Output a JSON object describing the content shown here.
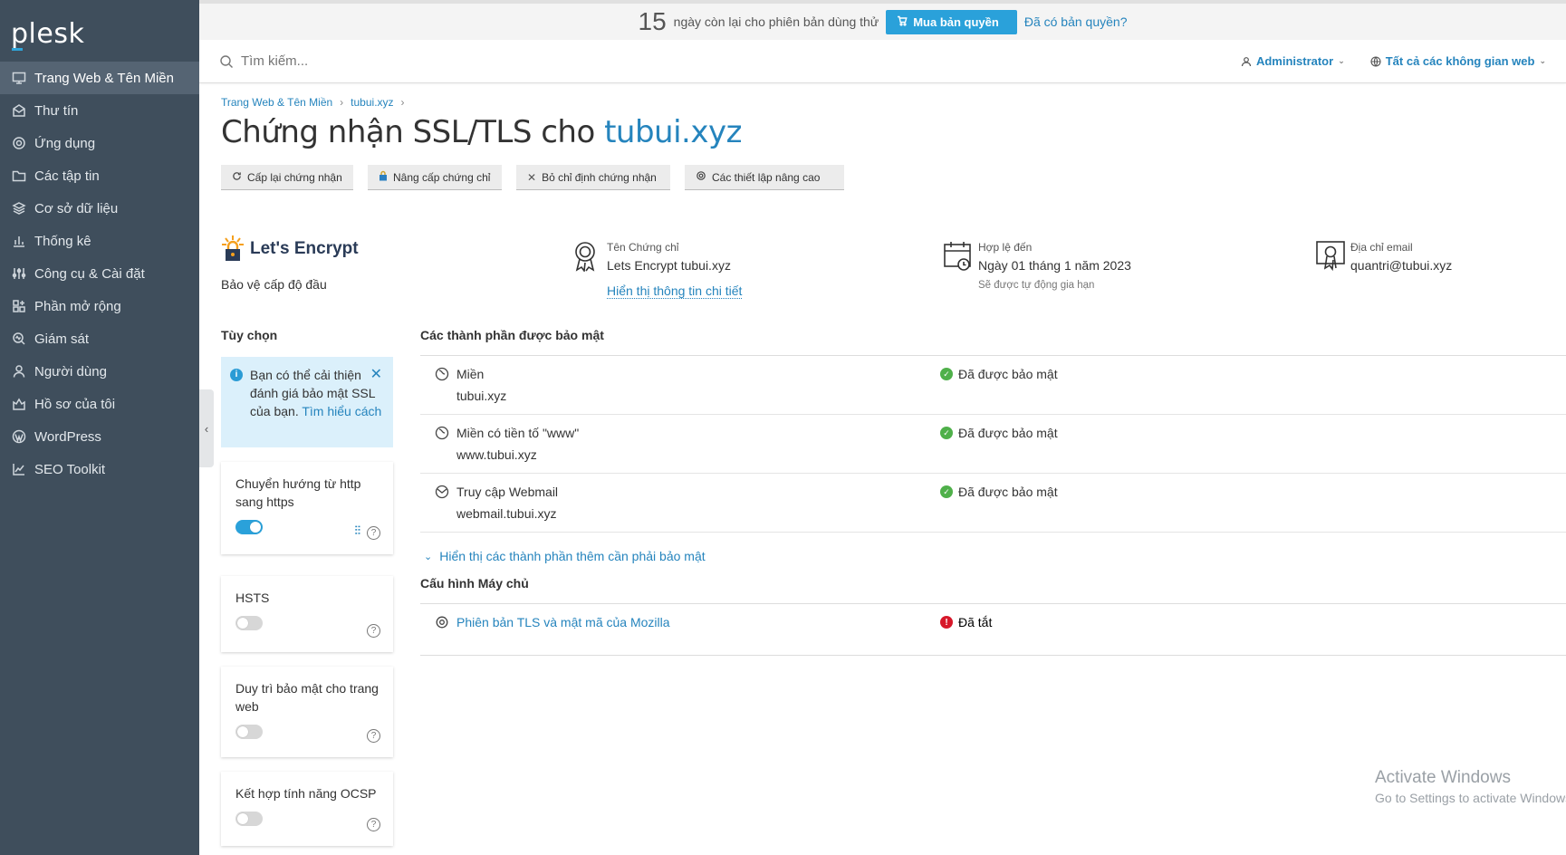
{
  "brand": "plesk",
  "sidebar": {
    "items": [
      {
        "label": "Trang Web & Tên Miền",
        "icon": "monitor-icon",
        "active": true
      },
      {
        "label": "Thư tín",
        "icon": "mail-icon"
      },
      {
        "label": "Ứng dụng",
        "icon": "gear-icon"
      },
      {
        "label": "Các tập tin",
        "icon": "folder-icon"
      },
      {
        "label": "Cơ sở dữ liệu",
        "icon": "layers-icon"
      },
      {
        "label": "Thống kê",
        "icon": "bar-chart-icon"
      },
      {
        "label": "Công cụ & Cài đặt",
        "icon": "sliders-icon"
      },
      {
        "label": "Phần mở rộng",
        "icon": "extensions-icon"
      },
      {
        "label": "Giám sát",
        "icon": "monitor-search-icon"
      },
      {
        "label": "Người dùng",
        "icon": "user-icon"
      },
      {
        "label": "Hồ sơ của tôi",
        "icon": "profile-icon"
      },
      {
        "label": "WordPress",
        "icon": "wordpress-icon"
      },
      {
        "label": "SEO Toolkit",
        "icon": "seo-chart-icon"
      }
    ]
  },
  "trial": {
    "days": "15",
    "text": "ngày còn lại cho phiên bản dùng thử",
    "buy_label": "Mua bản quyền",
    "have_license_label": "Đã có bản quyền?"
  },
  "search": {
    "placeholder": "Tìm kiếm..."
  },
  "topbar": {
    "user_label": "Administrator",
    "subscriptions_label": "Tất cả các không gian web"
  },
  "breadcrumb": {
    "item1": "Trang Web & Tên Miền",
    "item2": "tubui.xyz"
  },
  "page": {
    "title_prefix": "Chứng nhận SSL/TLS cho",
    "title_domain": "tubui.xyz"
  },
  "actions": {
    "reissue": "Cấp lại chứng nhận",
    "upgrade": "Nâng cấp chứng chỉ",
    "unassign": "Bỏ chỉ định chứng nhận",
    "advanced": "Các thiết lập nâng cao"
  },
  "overview": {
    "provider": "Let's Encrypt",
    "protection": "Bảo vệ cấp độ đầu",
    "cert_name_label": "Tên Chứng chỉ",
    "cert_name_value": "Lets Encrypt tubui.xyz",
    "cert_details_link": "Hiển thị thông tin chi tiết",
    "valid_label": "Hợp lệ đến",
    "valid_value": "Ngày 01 tháng 1 năm 2023",
    "valid_sub": "Sẽ được tự động gia hạn",
    "email_label": "Địa chỉ email",
    "email_value": "quantri@tubui.xyz"
  },
  "options": {
    "title": "Tùy chọn",
    "tip_text": "Bạn có thể cải thiện đánh giá bảo mật SSL của bạn.",
    "tip_link": "Tìm hiểu cách",
    "cards": [
      {
        "label": "Chuyển hướng từ http sang https",
        "on": true
      },
      {
        "label": "HSTS",
        "on": false
      },
      {
        "label": "Duy trì bảo mật cho trang web",
        "on": false
      },
      {
        "label": "Kết hợp tính năng OCSP",
        "on": false
      }
    ]
  },
  "secured": {
    "title": "Các thành phần được bảo mật",
    "rows": [
      {
        "name": "Miền",
        "domain": "tubui.xyz",
        "status": "Đã được bảo mật"
      },
      {
        "name": "Miền có tiền tố \"www\"",
        "domain": "www.tubui.xyz",
        "status": "Đã được bảo mật"
      },
      {
        "name": "Truy cập Webmail",
        "domain": "webmail.tubui.xyz",
        "status": "Đã được bảo mật"
      }
    ],
    "more_link": "Hiển thị các thành phần thêm cần phải bảo mật"
  },
  "server": {
    "title": "Cấu hình Máy chủ",
    "row_name": "Phiên bản TLS và mật mã của Mozilla",
    "row_status": "Đã tắt"
  },
  "watermark": {
    "line1": "Activate Windows",
    "line2": "Go to Settings to activate Windows."
  }
}
